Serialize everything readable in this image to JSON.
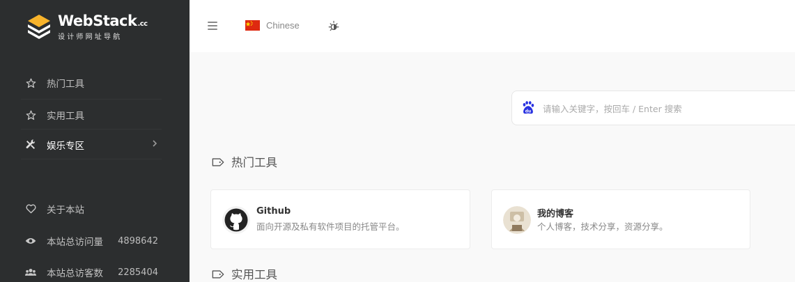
{
  "brand": {
    "title": "WebStack",
    "suffix": ".cc",
    "subtitle": "设计师网址导航"
  },
  "sidebar": {
    "items": [
      {
        "label": "热门工具",
        "icon": "star-icon"
      },
      {
        "label": "实用工具",
        "icon": "star-icon"
      },
      {
        "label": "娱乐专区",
        "icon": "tools-icon",
        "expandable": true
      }
    ],
    "bottom_items": [
      {
        "label": "关于本站",
        "icon": "heart-icon"
      },
      {
        "label": "本站总访问量",
        "icon": "eye-icon",
        "value": "4898642"
      },
      {
        "label": "本站总访客数",
        "icon": "users-icon",
        "value": "2285404"
      }
    ]
  },
  "topbar": {
    "language": "Chinese"
  },
  "search": {
    "placeholder": "请输入关键字，按回车 / Enter 搜索",
    "engine_icon": "baidu-icon"
  },
  "sections": [
    {
      "title": "热门工具",
      "cards": [
        {
          "title": "Github",
          "desc": "面向开源及私有软件项目的托管平台。",
          "icon": "github-icon"
        },
        {
          "title": "我的博客",
          "desc": "个人博客，技术分享，资源分享。",
          "icon": "blog-avatar"
        }
      ]
    },
    {
      "title": "实用工具"
    }
  ],
  "colors": {
    "sidebar_bg": "#2c2e2f",
    "page_bg": "#f9f9f9",
    "flag_red": "#de2910",
    "baidu_blue": "#2932e1"
  }
}
